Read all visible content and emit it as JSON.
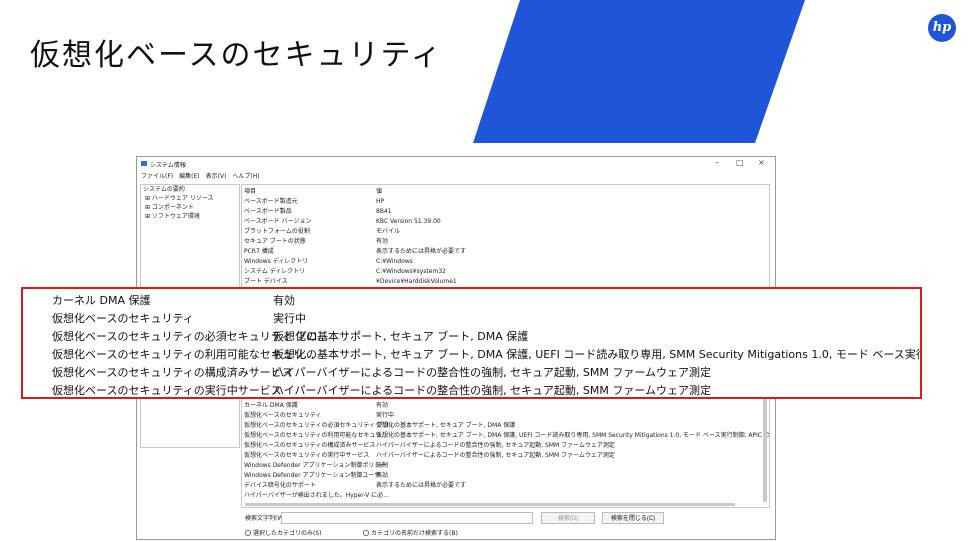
{
  "slide": {
    "title": "仮想化ベースのセキュリティ",
    "logo": "hp",
    "accent": "#1f56d8"
  },
  "window": {
    "title": "システム情報",
    "menu": [
      "ファイル(F)",
      "編集(E)",
      "表示(V)",
      "ヘルプ(H)"
    ],
    "tree": [
      {
        "label": "システムの要約",
        "child": false
      },
      {
        "label": "⊞ ハードウェア リソース",
        "child": true
      },
      {
        "label": "⊞ コンポーネント",
        "child": true
      },
      {
        "label": "⊞ ソフトウェア環境",
        "child": true
      }
    ],
    "headers": {
      "item": "項目",
      "value": "値"
    },
    "rows_top": [
      {
        "k": "ベースボード製造元",
        "v": "HP"
      },
      {
        "k": "ベースボード製品",
        "v": "8B41"
      },
      {
        "k": "ベースボード バージョン",
        "v": "KBC Version 51.39.00"
      },
      {
        "k": "プラットフォームの役割",
        "v": "モバイル"
      },
      {
        "k": "セキュア ブートの状態",
        "v": "有効"
      },
      {
        "k": "PCR7 構成",
        "v": "表示するためには昇格が必要です"
      },
      {
        "k": "Windows ディレクトリ",
        "v": "C:¥Windows"
      },
      {
        "k": "システム ディレクトリ",
        "v": "C:¥Windows¥system32"
      },
      {
        "k": "ブート デバイス",
        "v": "¥Device¥HarddiskVolume1"
      }
    ],
    "rows_bottom": [
      {
        "k": "カーネル DMA 保護",
        "v": "有効"
      },
      {
        "k": "仮想化ベースのセキュリティ",
        "v": "実行中"
      },
      {
        "k": "仮想化ベースのセキュリティの必須セキュリティ プロ...",
        "v": "仮想化の基本サポート, セキュア ブート, DMA 保護"
      },
      {
        "k": "仮想化ベースのセキュリティの利用可能なセキュリ...",
        "v": "仮想化の基本サポート, セキュア ブート, DMA 保護, UEFI コード読み取り専用, SMM Security Mitigations 1.0, モード ベース実行制御, APIC の仮想化"
      },
      {
        "k": "仮想化ベースのセキュリティの構成済みサービス",
        "v": "ハイパーバイザーによるコードの整合性の強制, セキュア起動, SMM ファームウェア測定"
      },
      {
        "k": "仮想化ベースのセキュリティの実行中サービス",
        "v": "ハイパーバイザーによるコードの整合性の強制, セキュア起動, SMM ファームウェア測定"
      },
      {
        "k": "Windows Defender アプリケーション制御ポリシー",
        "v": "強制"
      },
      {
        "k": "Windows Defender アプリケーション制御ユーザ...",
        "v": "無効"
      },
      {
        "k": "デバイス暗号化のサポート",
        "v": "表示するためには昇格が必要です"
      },
      {
        "k": "ハイパーバイザーが検出されました。Hyper-V に必...",
        "v": ""
      }
    ],
    "search": {
      "label": "検索文字列(W):",
      "value": "",
      "find_label": "検索(D)",
      "close_label": "検索を閉じる(C)",
      "check1": "選択したカテゴリのみ(S)",
      "check2": "カテゴリの名前だけ検索する(B)"
    }
  },
  "zoom_rows": [
    {
      "k": "カーネル DMA 保護",
      "v": "有効"
    },
    {
      "k": "仮想化ベースのセキュリティ",
      "v": "実行中"
    },
    {
      "k": "仮想化ベースのセキュリティの必須セキュリティ プロ...",
      "v": "仮想化の基本サポート, セキュア ブート, DMA 保護"
    },
    {
      "k": "仮想化ベースのセキュリティの利用可能なセキュリ...",
      "v": "仮想化の基本サポート, セキュア ブート, DMA 保護, UEFI コード読み取り専用, SMM Security Mitigations 1.0, モード ベース実行制御, APIC の仮想化"
    },
    {
      "k": "仮想化ベースのセキュリティの構成済みサービス",
      "v": "ハイパーバイザーによるコードの整合性の強制, セキュア起動, SMM ファームウェア測定"
    },
    {
      "k": "仮想化ベースのセキュリティの実行中サービス",
      "v": "ハイパーバイザーによるコードの整合性の強制, セキュア起動, SMM ファームウェア測定"
    }
  ],
  "highlight_color": "#d81b1b"
}
